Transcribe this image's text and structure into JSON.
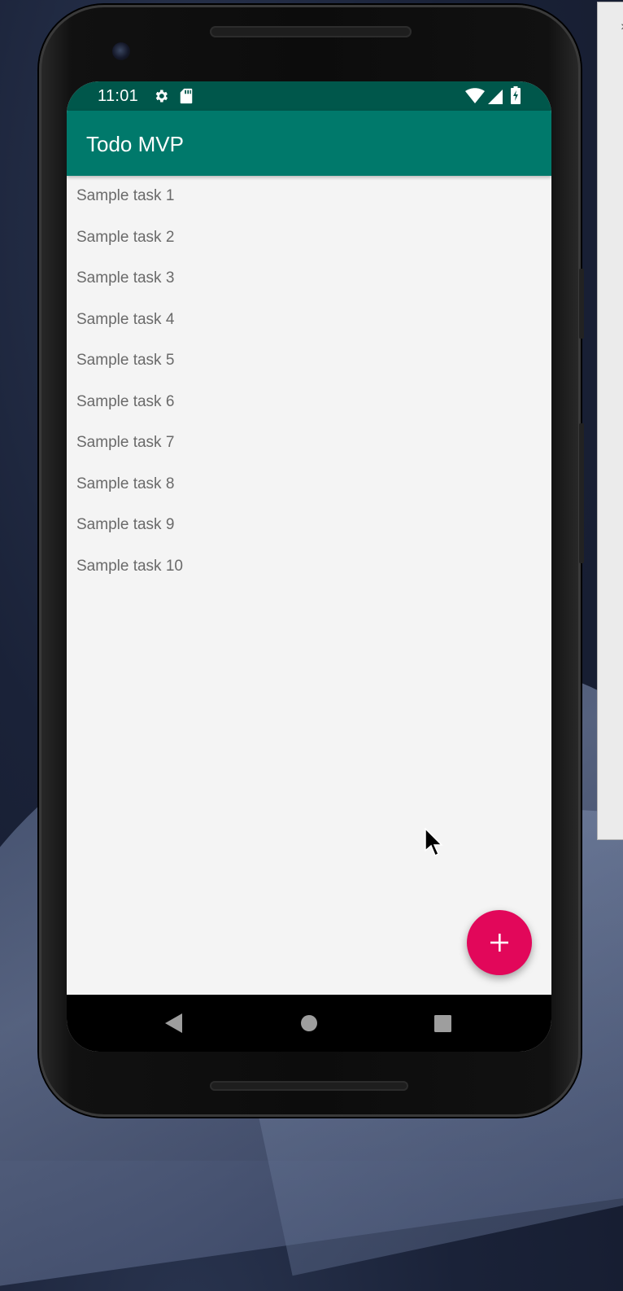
{
  "status_bar": {
    "time": "11:01",
    "icons": [
      "gear-icon",
      "sd-card-icon",
      "wifi-icon",
      "cell-signal-icon",
      "battery-charging-icon"
    ]
  },
  "app_bar": {
    "title": "Todo MVP"
  },
  "tasks": [
    {
      "label": "Sample task 1"
    },
    {
      "label": "Sample task 2"
    },
    {
      "label": "Sample task 3"
    },
    {
      "label": "Sample task 4"
    },
    {
      "label": "Sample task 5"
    },
    {
      "label": "Sample task 6"
    },
    {
      "label": "Sample task 7"
    },
    {
      "label": "Sample task 8"
    },
    {
      "label": "Sample task 9"
    },
    {
      "label": "Sample task 10"
    }
  ],
  "fab": {
    "icon": "plus-icon",
    "color": "#e2075a"
  },
  "navigation_bar": {
    "icons": [
      "back-icon",
      "home-icon",
      "recents-icon"
    ]
  },
  "colors": {
    "status_bar": "#00574b",
    "app_bar": "#00796b",
    "background": "#f4f4f4",
    "task_text": "#6a6a6a"
  }
}
